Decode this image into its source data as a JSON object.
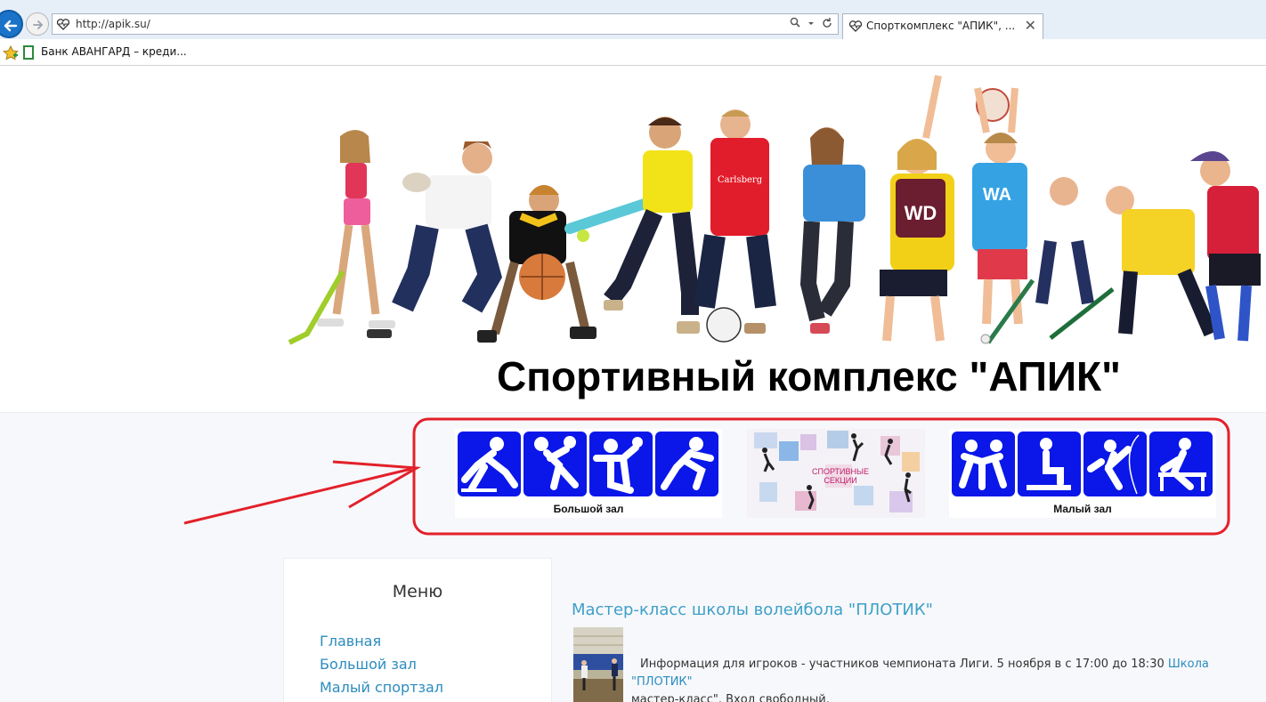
{
  "browser": {
    "url": "http://apik.su/",
    "tab_title": "Спорткомплекс \"АПИК\", ...",
    "tab_close": "✕",
    "bookmark_label": "Банк АВАНГАРД – креди..."
  },
  "site": {
    "title": "Спортивный комплекс \"АПИК\"",
    "hero_jersey_texts": [
      "Carlsberg",
      "WD",
      "WA"
    ]
  },
  "banners": {
    "big_hall": "Большой зал",
    "sections_line1": "СПОРТИВНЫЕ",
    "sections_line2": "СЕКЦИИ",
    "small_hall": "Малый зал"
  },
  "sidebar": {
    "title": "Меню",
    "items": [
      {
        "label": "Главная"
      },
      {
        "label": "Большой зал"
      },
      {
        "label": "Малый спортзал"
      }
    ]
  },
  "article": {
    "title": "Мастер-класс школы волейбола \"ПЛОТИК\"",
    "text_before_link": "Информация для игроков - участников чемпионата Лиги. 5 ноября в с 17:00 до 18:30 ",
    "link_text": "Школа \"ПЛОТИК\"",
    "text_after_link": "мастер-класс\". Вход свободный."
  },
  "colors": {
    "pictogram_blue": "#0a17e8",
    "annotation_red": "#e3202a",
    "link_blue": "#2b8cbe"
  },
  "icons": [
    "back-arrow-icon",
    "forward-arrow-icon",
    "site-favicon",
    "search-icon",
    "refresh-icon",
    "favorites-star-icon",
    "bookmark-favicon"
  ]
}
